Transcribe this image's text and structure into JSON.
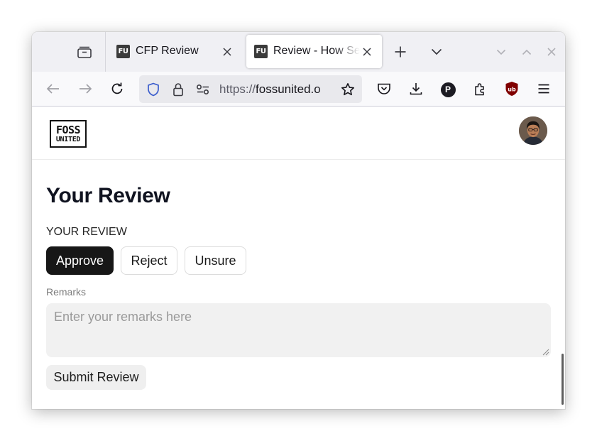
{
  "browser": {
    "tabs": [
      {
        "title": "CFP Review",
        "favicon": "FU",
        "active": false
      },
      {
        "title": "Review - How Se",
        "favicon": "FU",
        "active": true
      }
    ],
    "url": {
      "scheme": "https://",
      "host": "fossunited.o"
    },
    "toolbar_icons": [
      "back-icon",
      "forward-icon",
      "reload-icon",
      "shield-icon",
      "lock-icon",
      "permissions-icon",
      "bookmark-star-icon",
      "pocket-icon",
      "download-icon",
      "profile-p-icon",
      "extensions-icon",
      "ublock-icon",
      "menu-icon"
    ],
    "tabbar_icons": [
      "tab-groups-icon",
      "new-tab-icon",
      "tab-list-icon",
      "minimize-icon",
      "maximize-icon",
      "close-window-icon"
    ],
    "profile_letter": "P",
    "ublock_label": "ub"
  },
  "site": {
    "logo_line1": "FOSS",
    "logo_line2": "UNITED"
  },
  "review": {
    "heading": "Your Review",
    "section_label": "YOUR REVIEW",
    "options": [
      "Approve",
      "Reject",
      "Unsure"
    ],
    "selected_option": "Approve",
    "remarks_label": "Remarks",
    "remarks_placeholder": "Enter your remarks here",
    "remarks_value": "",
    "submit_label": "Submit Review"
  },
  "colors": {
    "selected_button": "#171717",
    "ublock_red": "#800000",
    "shield_blue": "#3a5ccc"
  }
}
